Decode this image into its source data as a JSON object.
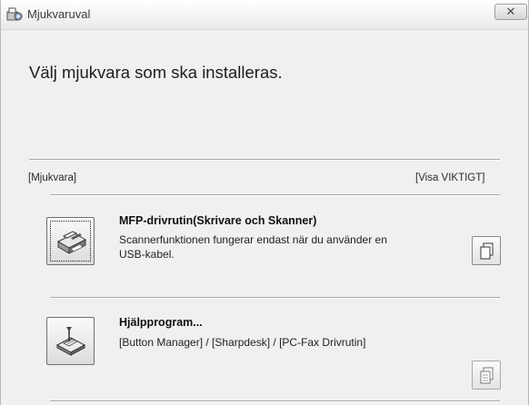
{
  "window": {
    "title": "Mjukvaruval",
    "close_glyph": "✕"
  },
  "heading": "Välj mjukvara som ska installeras.",
  "section": {
    "left_label": "[Mjukvara]",
    "right_label": "[Visa VIKTIGT]"
  },
  "items": [
    {
      "title": "MFP-drivrutin(Skrivare och Skanner)",
      "description_line1": "Scannerfunktionen fungerar endast när du använder en",
      "description_line2": "USB-kabel.",
      "icon": "printer-scanner-icon",
      "doc_icon": "document-icon"
    },
    {
      "title": "Hjälpprogram...",
      "description_line1": "[Button Manager] / [Sharpdesk] / [PC-Fax Drivrutin]",
      "icon": "utility-software-icon",
      "doc_icon": "document-icon"
    }
  ]
}
